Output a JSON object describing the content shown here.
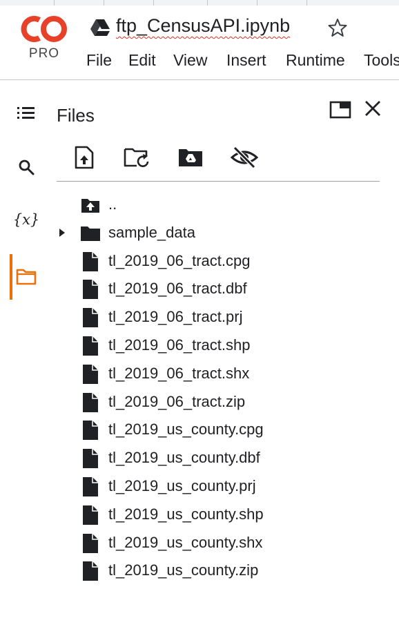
{
  "app": {
    "logo_text": "CO",
    "logo_badge": "PRO",
    "notebook_title": "ftp_CensusAPI.ipynb",
    "brand_color": "#e8710a",
    "logo_color": "#e8412a"
  },
  "menu": {
    "items": [
      "File",
      "Edit",
      "View",
      "Insert",
      "Runtime",
      "Tools"
    ]
  },
  "rail": {
    "icons": [
      "table-of-contents-icon",
      "search-icon",
      "variables-icon",
      "files-icon"
    ],
    "variables_label": "{x}"
  },
  "files_panel": {
    "title": "Files",
    "toolbar": [
      "upload-icon",
      "refresh-icon",
      "mount-drive-icon",
      "hide-hidden-files-icon"
    ],
    "entries": [
      {
        "name": "..",
        "type": "parent"
      },
      {
        "name": "sample_data",
        "type": "folder"
      },
      {
        "name": "tl_2019_06_tract.cpg",
        "type": "file"
      },
      {
        "name": "tl_2019_06_tract.dbf",
        "type": "file"
      },
      {
        "name": "tl_2019_06_tract.prj",
        "type": "file"
      },
      {
        "name": "tl_2019_06_tract.shp",
        "type": "file"
      },
      {
        "name": "tl_2019_06_tract.shx",
        "type": "file"
      },
      {
        "name": "tl_2019_06_tract.zip",
        "type": "file"
      },
      {
        "name": "tl_2019_us_county.cpg",
        "type": "file"
      },
      {
        "name": "tl_2019_us_county.dbf",
        "type": "file"
      },
      {
        "name": "tl_2019_us_county.prj",
        "type": "file"
      },
      {
        "name": "tl_2019_us_county.shp",
        "type": "file"
      },
      {
        "name": "tl_2019_us_county.shx",
        "type": "file"
      },
      {
        "name": "tl_2019_us_county.zip",
        "type": "file"
      }
    ]
  }
}
